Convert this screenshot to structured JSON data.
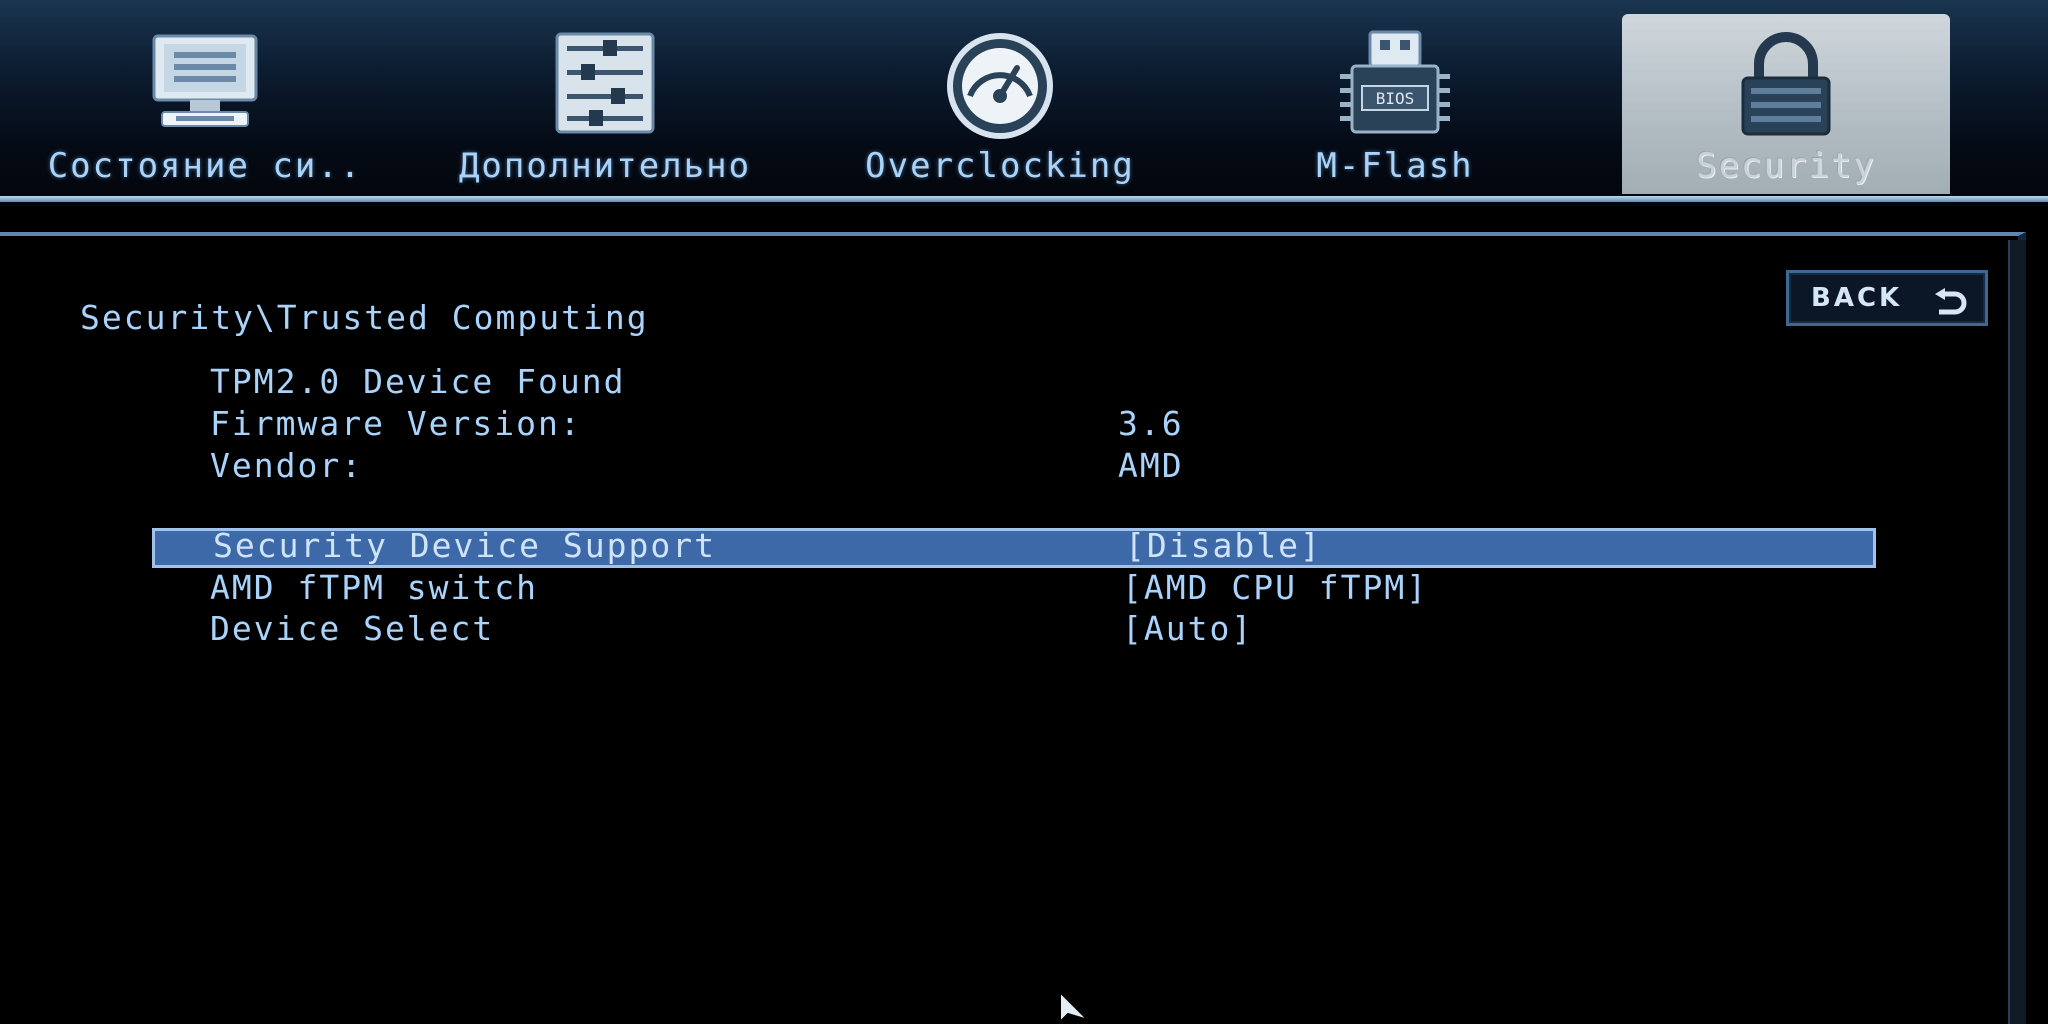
{
  "tabs": [
    {
      "label": "Состояние си..",
      "icon": "monitor-icon",
      "active": false
    },
    {
      "label": "Дополнительно",
      "icon": "sliders-icon",
      "active": false
    },
    {
      "label": "Overclocking",
      "icon": "speedometer-icon",
      "active": false
    },
    {
      "label": "M-Flash",
      "icon": "bios-chip-icon",
      "chip_text": "BIOS",
      "active": false
    },
    {
      "label": "Security",
      "icon": "padlock-icon",
      "active": true
    }
  ],
  "back_button": {
    "label": "BACK",
    "icon": "return-arrow-icon"
  },
  "breadcrumb": "Security\\Trusted Computing",
  "info": {
    "status": "TPM2.0 Device Found",
    "firmware_label": "Firmware Version:",
    "firmware_value": "3.6",
    "vendor_label": "Vendor:",
    "vendor_value": "AMD"
  },
  "settings": [
    {
      "label": "Security Device Support",
      "value": "[Disable]",
      "selected": true
    },
    {
      "label": "AMD fTPM switch",
      "value": "[AMD CPU fTPM]",
      "selected": false
    },
    {
      "label": "Device Select",
      "value": "[Auto]",
      "selected": false
    }
  ],
  "colors": {
    "text": "#a9d3fa",
    "highlight": "#3d69a8",
    "active_tab": "#b2bcc3",
    "background": "#000000"
  }
}
